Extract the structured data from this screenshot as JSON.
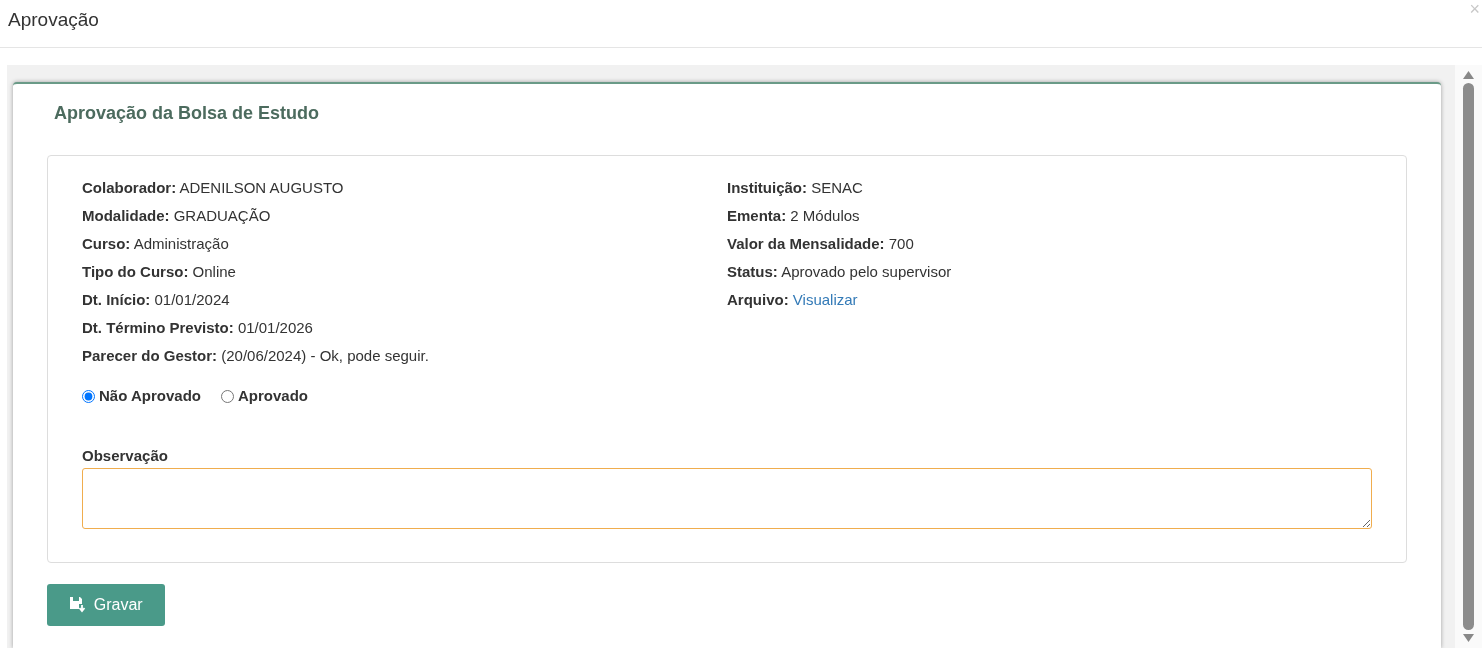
{
  "window": {
    "title": "Aprovação",
    "close": "×"
  },
  "card": {
    "title": "Aprovação da Bolsa de Estudo"
  },
  "details_left": [
    {
      "label": "Colaborador:",
      "value": "ADENILSON AUGUSTO"
    },
    {
      "label": "Modalidade:",
      "value": "GRADUAÇÃO"
    },
    {
      "label": "Curso:",
      "value": "Administração"
    },
    {
      "label": "Tipo do Curso:",
      "value": "Online"
    },
    {
      "label": "Dt. Início:",
      "value": "01/01/2024"
    },
    {
      "label": "Dt. Término Previsto:",
      "value": "01/01/2026"
    },
    {
      "label": "Parecer do Gestor:",
      "value": "(20/06/2024) - Ok, pode seguir."
    }
  ],
  "details_right": [
    {
      "label": "Instituição:",
      "value": "SENAC",
      "kind": "text"
    },
    {
      "label": "Ementa:",
      "value": "2 Módulos",
      "kind": "text"
    },
    {
      "label": "Valor da Mensalidade:",
      "value": "700",
      "kind": "text"
    },
    {
      "label": "Status:",
      "value": "Aprovado pelo supervisor",
      "kind": "text"
    },
    {
      "label": "Arquivo:",
      "value": "Visualizar",
      "kind": "link"
    }
  ],
  "decision": [
    {
      "label": "Não Aprovado",
      "selected": true
    },
    {
      "label": "Aprovado",
      "selected": false
    }
  ],
  "observation": {
    "label": "Observação"
  },
  "save_button": {
    "label": "Gravar"
  }
}
